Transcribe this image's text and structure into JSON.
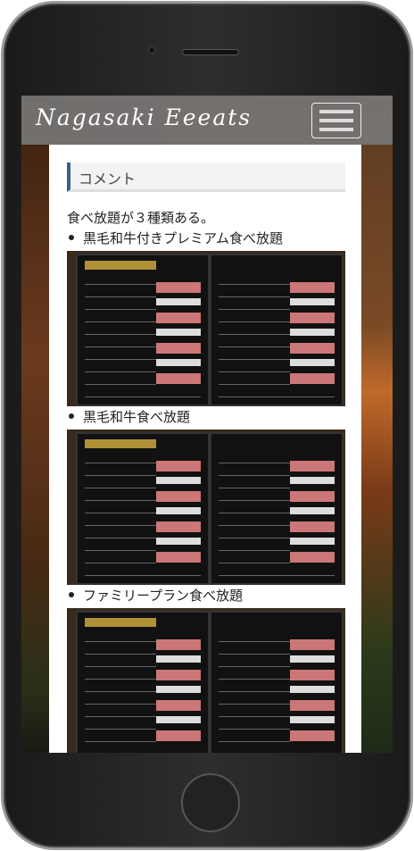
{
  "header": {
    "logo": "Nagasaki Eeeats",
    "menu_icon": "hamburger-icon"
  },
  "section": {
    "heading": "コメント",
    "intro": "食べ放題が３種類ある。",
    "items": [
      {
        "label": "黒毛和牛付きプレミアム食べ放題"
      },
      {
        "label": "黒毛和牛食べ放題"
      },
      {
        "label": "ファミリープラン食べ放題"
      }
    ]
  },
  "colors": {
    "accent": "#3a5f8a",
    "header_bg": "#787878"
  }
}
